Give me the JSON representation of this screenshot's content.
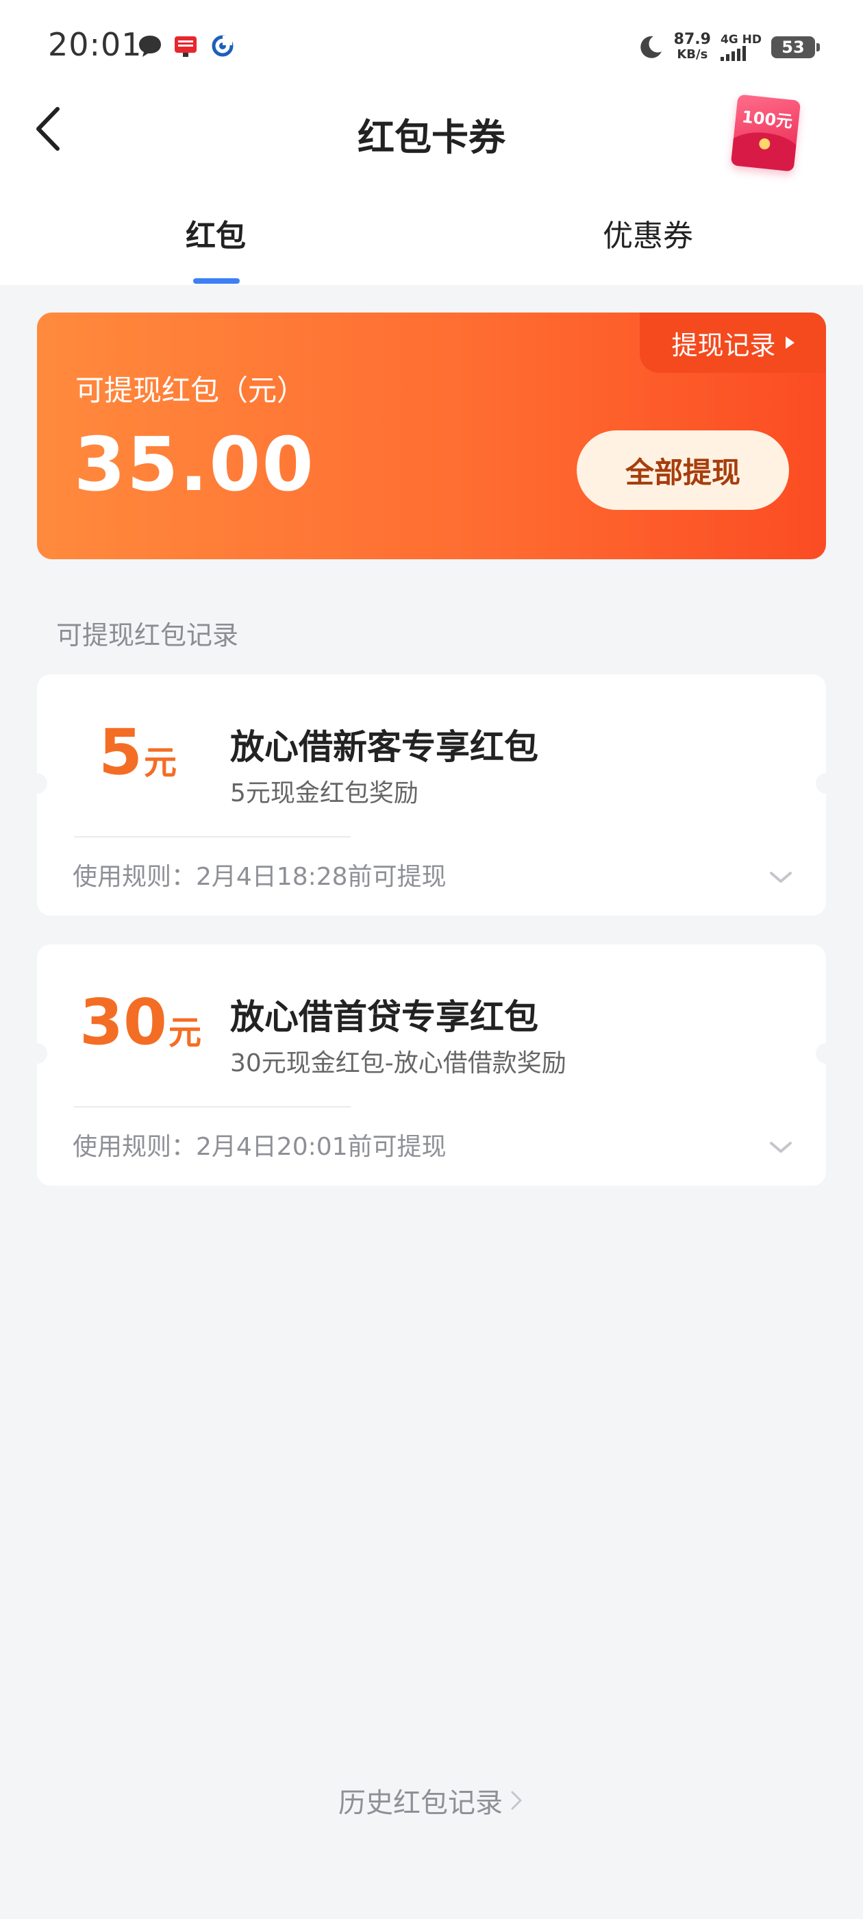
{
  "status_bar": {
    "time": "20:01",
    "net_speed_value": "87.9",
    "net_speed_unit": "KB/s",
    "network_type": "4G HD",
    "battery": "53",
    "notification_icons": [
      "chat-bubble-icon",
      "app-badge-icon",
      "swirl-logo-icon"
    ]
  },
  "header": {
    "title": "红包卡券",
    "promo_badge": "100元"
  },
  "tabs": [
    {
      "label": "红包",
      "active": true
    },
    {
      "label": "优惠券",
      "active": false
    }
  ],
  "balance": {
    "label": "可提现红包（元）",
    "amount": "35.00",
    "record_link": "提现记录",
    "withdraw_button": "全部提现"
  },
  "records_section": {
    "title": "可提现红包记录"
  },
  "red_packets": [
    {
      "amount": "5",
      "unit": "元",
      "title": "放心借新客专享红包",
      "desc": "5元现金红包奖励",
      "rule": "使用规则：2月4日18:28前可提现"
    },
    {
      "amount": "30",
      "unit": "元",
      "title": "放心借首贷专享红包",
      "desc": "30元现金红包-放心借借款奖励",
      "rule": "使用规则：2月4日20:01前可提现"
    }
  ],
  "footer": {
    "history_link": "历史红包记录"
  },
  "colors": {
    "accent_orange": "#f46d24",
    "tab_indicator": "#3d7ff5",
    "card_gradient_start": "#ff8a3d",
    "card_gradient_end": "#fb4c23"
  }
}
